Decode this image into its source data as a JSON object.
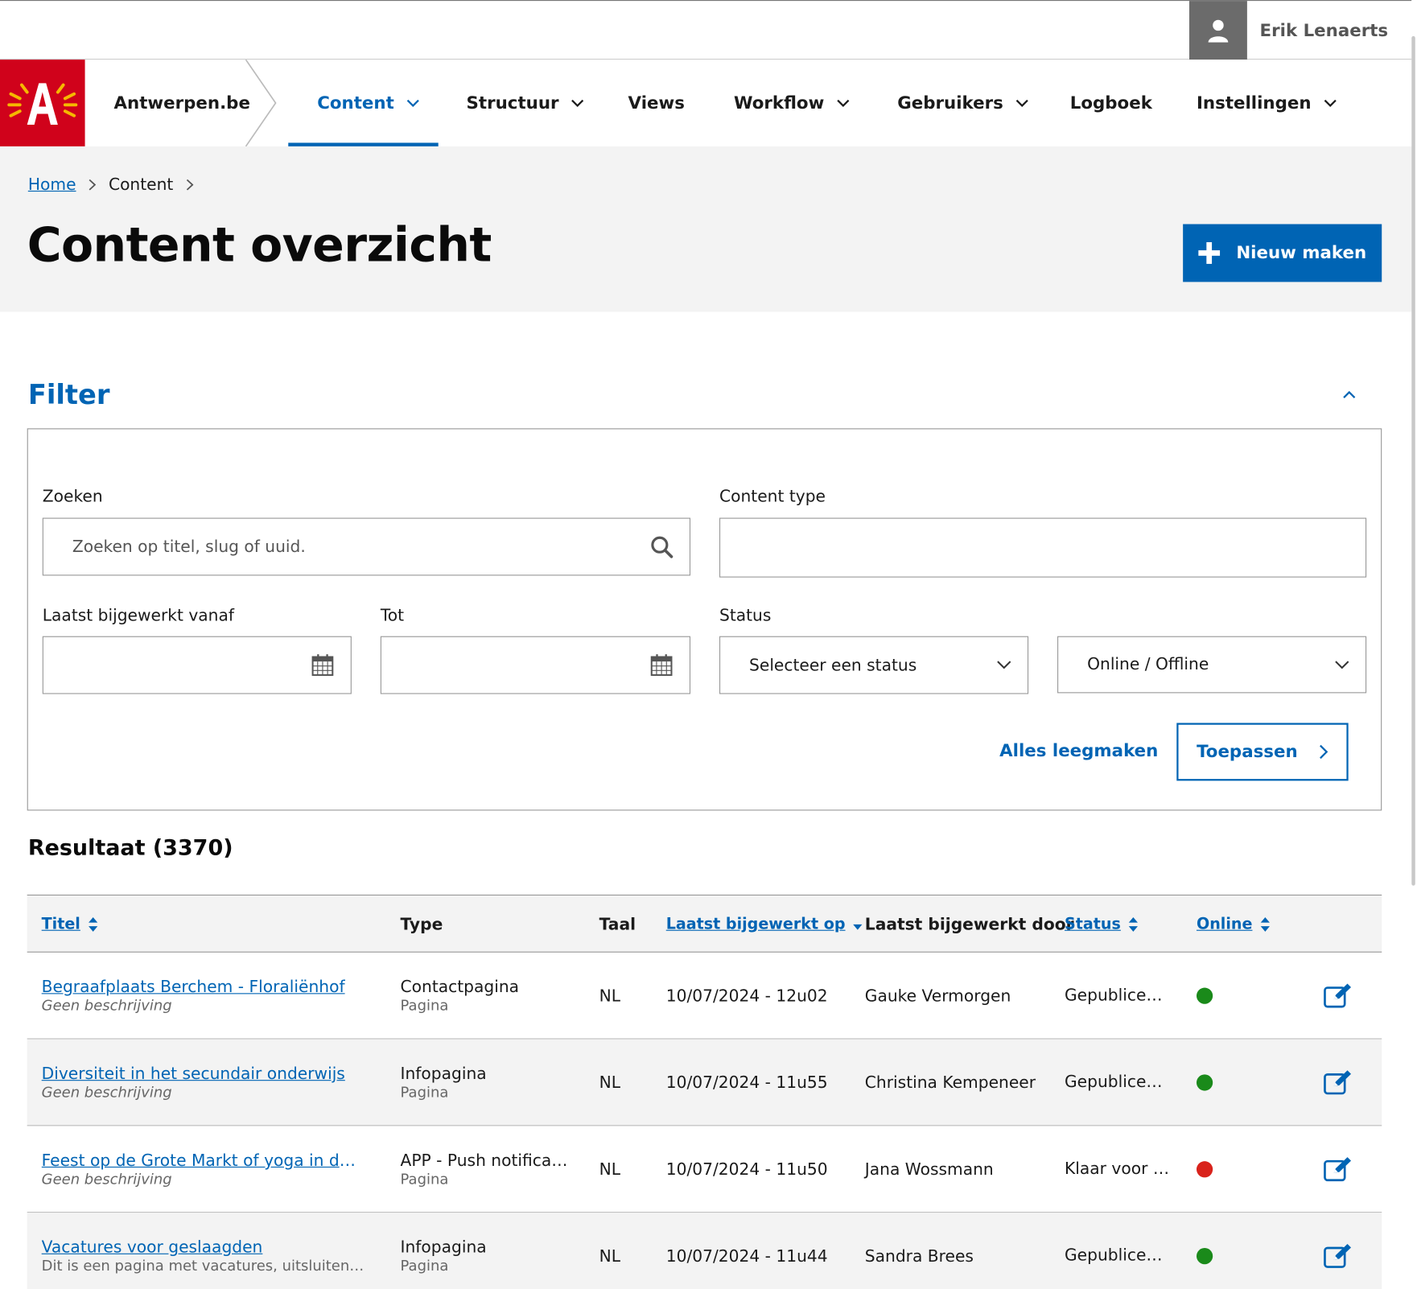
{
  "user": {
    "name": "Erik Lenaerts"
  },
  "site": {
    "name": "Antwerpen.be"
  },
  "nav": [
    {
      "label": "Content",
      "dropdown": true,
      "active": true
    },
    {
      "label": "Structuur",
      "dropdown": true
    },
    {
      "label": "Views",
      "dropdown": false
    },
    {
      "label": "Workflow",
      "dropdown": true
    },
    {
      "label": "Gebruikers",
      "dropdown": true
    },
    {
      "label": "Logboek",
      "dropdown": false
    },
    {
      "label": "Instellingen",
      "dropdown": true
    }
  ],
  "breadcrumb": {
    "home": "Home",
    "current": "Content"
  },
  "page": {
    "title": "Content overzicht",
    "new_button": "Nieuw maken"
  },
  "filter": {
    "title": "Filter",
    "search_label": "Zoeken",
    "search_placeholder": "Zoeken op titel, slug of uuid.",
    "content_type_label": "Content type",
    "from_label": "Laatst bijgewerkt vanaf",
    "to_label": "Tot",
    "status_label": "Status",
    "status_select": "Selecteer een status",
    "online_select": "Online / Offline",
    "clear": "Alles leegmaken",
    "apply": "Toepassen"
  },
  "results": {
    "title": "Resultaat (3370)",
    "columns": {
      "title": "Titel",
      "type": "Type",
      "lang": "Taal",
      "updated_at": "Laatst bijgewerkt op",
      "updated_by": "Laatst bijgewerkt door",
      "status": "Status",
      "online": "Online"
    },
    "rows": [
      {
        "title": "Begraafplaats Berchem - Floraliënhof",
        "desc": "Geen beschrijving",
        "type": "Contactpagina",
        "subtype": "Pagina",
        "lang": "NL",
        "date": "10/07/2024 - 12u02",
        "by": "Gauke Vermorgen",
        "status": "Gepubliceerd",
        "online_color": "#1a8a1a"
      },
      {
        "title": "Diversiteit in het secundair onderwijs",
        "desc": "Geen beschrijving",
        "type": "Infopagina",
        "subtype": "Pagina",
        "lang": "NL",
        "date": "10/07/2024 - 11u55",
        "by": "Christina Kempeneer",
        "status": "Gepubliceerd",
        "online_color": "#1a8a1a"
      },
      {
        "title": "Feest op de Grote Markt of yoga in de park",
        "desc": "Geen beschrijving",
        "type": "APP - Push notificatie",
        "subtype": "Pagina",
        "lang": "NL",
        "date": "10/07/2024 - 11u50",
        "by": "Jana Wossmann",
        "status": "Klaar voor publicatie",
        "online_color": "#d9231c"
      },
      {
        "title": "Vacatures voor geslaagden",
        "desc": "Dit is een pagina met vacatures, uitsluitend voor",
        "type": "Infopagina",
        "subtype": "Pagina",
        "lang": "NL",
        "date": "10/07/2024 - 11u44",
        "by": "Sandra Brees",
        "status": "Gepubliceerd",
        "online_color": "#1a8a1a"
      }
    ]
  },
  "colors": {
    "brand_red": "#d0021b",
    "accent_blue": "#0064b4"
  }
}
